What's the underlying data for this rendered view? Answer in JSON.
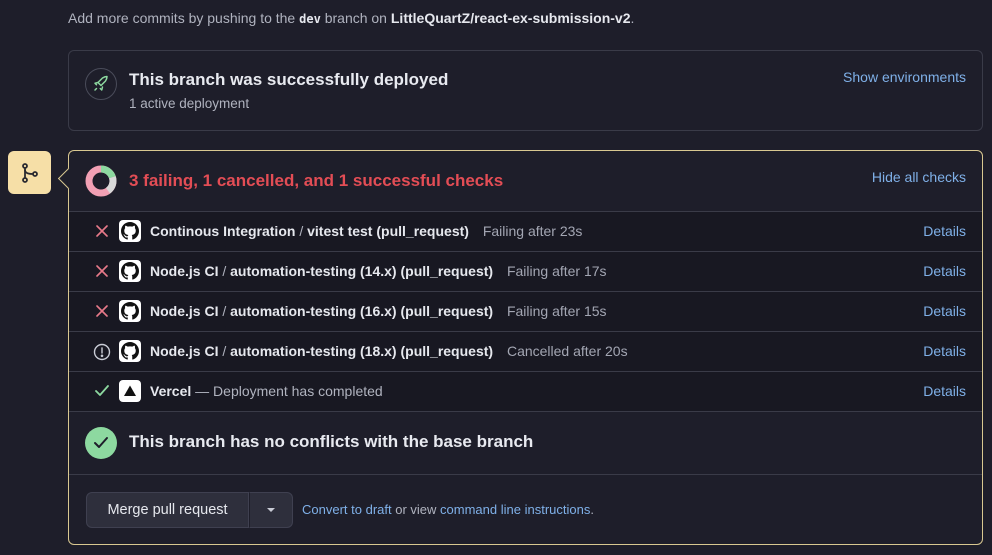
{
  "topline": {
    "prefix": "Add more commits by pushing to the",
    "branch": "dev",
    "middle": "branch on",
    "repo": "LittleQuartZ/react-ex-submission-v2",
    "suffix": "."
  },
  "deployment": {
    "title": "This branch was successfully deployed",
    "subtitle": "1 active deployment",
    "show_environments": "Show environments",
    "icon": "rocket-icon"
  },
  "checks": {
    "title": "3 failing, 1 cancelled, and 1 successful checks",
    "hide_all": "Hide all checks",
    "summary_counts": {
      "failing": 3,
      "cancelled": 1,
      "successful": 1
    },
    "rows": [
      {
        "status_icon": "x-icon",
        "app_icon": "github-icon",
        "workflow": "Continous Integration",
        "sep": "/",
        "job": "vitest test (pull_request)",
        "status": "Failing after 23s",
        "details": "Details"
      },
      {
        "status_icon": "x-icon",
        "app_icon": "github-icon",
        "workflow": "Node.js CI",
        "sep": "/",
        "job": "automation-testing (14.x) (pull_request)",
        "status": "Failing after 17s",
        "details": "Details"
      },
      {
        "status_icon": "x-icon",
        "app_icon": "github-icon",
        "workflow": "Node.js CI",
        "sep": "/",
        "job": "automation-testing (16.x) (pull_request)",
        "status": "Failing after 15s",
        "details": "Details"
      },
      {
        "status_icon": "alert-circle-icon",
        "app_icon": "github-icon",
        "workflow": "Node.js CI",
        "sep": "/",
        "job": "automation-testing (18.x) (pull_request)",
        "status": "Cancelled after 20s",
        "details": "Details"
      },
      {
        "status_icon": "check-icon",
        "app_icon": "vercel-icon",
        "workflow": "Vercel",
        "sep": "—",
        "job": "",
        "status": "Deployment has completed",
        "details": "Details"
      }
    ]
  },
  "conflicts": {
    "title": "This branch has no conflicts with the base branch"
  },
  "merge": {
    "button": "Merge pull request",
    "convert_draft": "Convert to draft",
    "or_view": "or view",
    "cli_instructions": "command line instructions",
    "period": "."
  },
  "colors": {
    "fail": "#e34d55",
    "success": "#8dd9a0",
    "link": "#7fb0e8",
    "branch_badge": "#f6dfa7",
    "box_border_highlight": "#d9c891"
  }
}
